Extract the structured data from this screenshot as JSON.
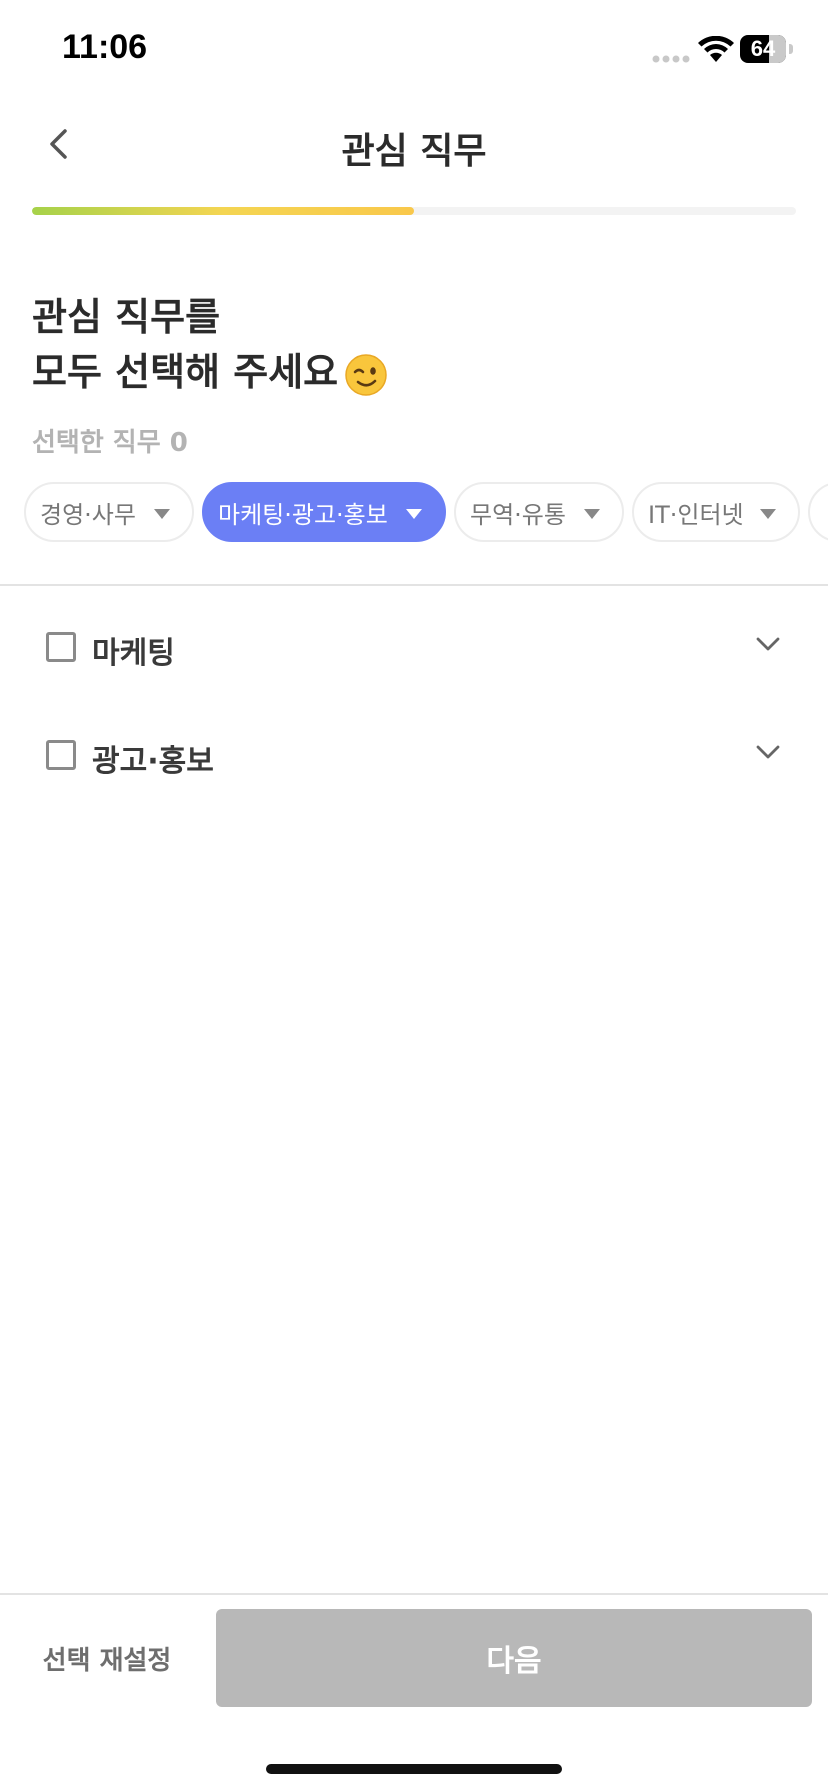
{
  "status_bar": {
    "time": "11:06",
    "battery_level": "64",
    "battery_fraction": 0.64
  },
  "header": {
    "title": "관심 직무"
  },
  "progress": {
    "fraction": 0.5,
    "colors": [
      "#a6d24a",
      "#f9c84b"
    ]
  },
  "heading": {
    "line1": "관심 직무를",
    "line2": "모두 선택해 주세요"
  },
  "selected": {
    "label": "선택한 직무",
    "count": "0"
  },
  "chips": [
    {
      "label": "경영·사무",
      "active": false
    },
    {
      "label": "마케팅·광고·홍보",
      "active": true
    },
    {
      "label": "무역·유통",
      "active": false
    },
    {
      "label": "IT·인터넷",
      "active": false
    }
  ],
  "jobs": [
    {
      "label": "마케팅",
      "checked": false
    },
    {
      "label": "광고·홍보",
      "checked": false
    }
  ],
  "footer": {
    "reset_label": "선택 재설정",
    "next_label": "다음"
  },
  "colors": {
    "accent": "#6b7ff5",
    "disabled": "#b8b8b8"
  }
}
